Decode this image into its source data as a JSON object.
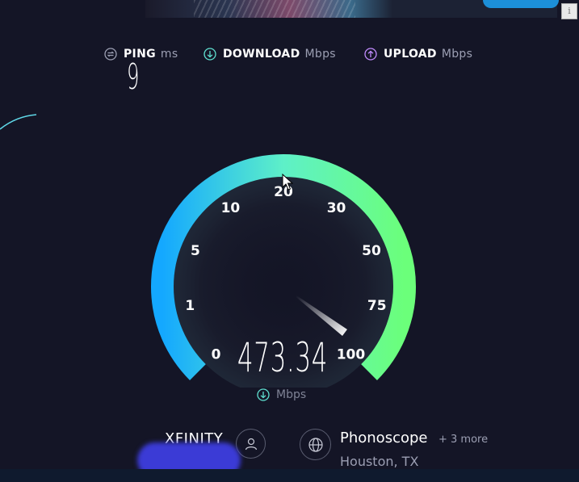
{
  "header": {
    "ping": {
      "label": "PING",
      "unit": "ms",
      "value": "9"
    },
    "download": {
      "label": "DOWNLOAD",
      "unit": "Mbps"
    },
    "upload": {
      "label": "UPLOAD",
      "unit": "Mbps"
    }
  },
  "gauge": {
    "ticks": [
      "0",
      "1",
      "5",
      "10",
      "20",
      "30",
      "50",
      "75",
      "100"
    ],
    "needle_position_fraction": 0.97,
    "colors": {
      "start": "#14a8ff",
      "mid": "#5ef0c8",
      "end": "#6bff7a"
    }
  },
  "result": {
    "value": "473.34",
    "unit": "Mbps"
  },
  "provider": {
    "name": "XFINITY"
  },
  "server": {
    "name": "Phonoscope",
    "more": "+ 3 more",
    "location": "Houston, TX"
  },
  "colors": {
    "background": "#141526",
    "ping_icon": "#9c9fb3",
    "download_icon": "#5fe0d0",
    "upload_icon": "#c28cff"
  },
  "icons": {
    "ping": "ping-icon",
    "download": "download-icon",
    "upload": "upload-icon",
    "user": "user-icon",
    "globe": "globe-icon",
    "info": "info-icon"
  }
}
